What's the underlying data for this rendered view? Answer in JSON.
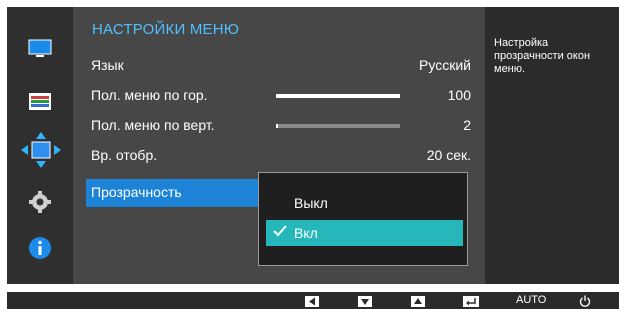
{
  "menu": {
    "title": "НАСТРОЙКИ МЕНЮ",
    "description": "Настройка прозрачности окон меню.",
    "items": [
      {
        "label": "Язык",
        "value": "Русский"
      },
      {
        "label": "Пол. меню по гор.",
        "value": "100",
        "level_percent": 100
      },
      {
        "label": "Пол. меню по верт.",
        "value": "2",
        "level_percent": 2
      },
      {
        "label": "Вр. отобр.",
        "value": "20 сек."
      },
      {
        "label": "Прозрачность",
        "value": ""
      }
    ]
  },
  "dropdown": {
    "options": [
      {
        "label": "Выкл",
        "selected": false
      },
      {
        "label": "Вкл",
        "selected": true
      }
    ]
  },
  "sidebar": {
    "icons": [
      "picture-icon",
      "color-icon",
      "size-position-icon",
      "settings-gear-icon",
      "info-icon"
    ],
    "active_index": 2
  },
  "bottom_bar": {
    "buttons": [
      "left-arrow-icon",
      "down-arrow-icon",
      "up-arrow-icon",
      "enter-icon",
      "auto-button",
      "power-icon"
    ],
    "auto_label": "AUTO"
  },
  "colors": {
    "accent_blue": "#1c83d6",
    "title_blue": "#4fc0ff",
    "selected_teal": "#25b7b9"
  }
}
